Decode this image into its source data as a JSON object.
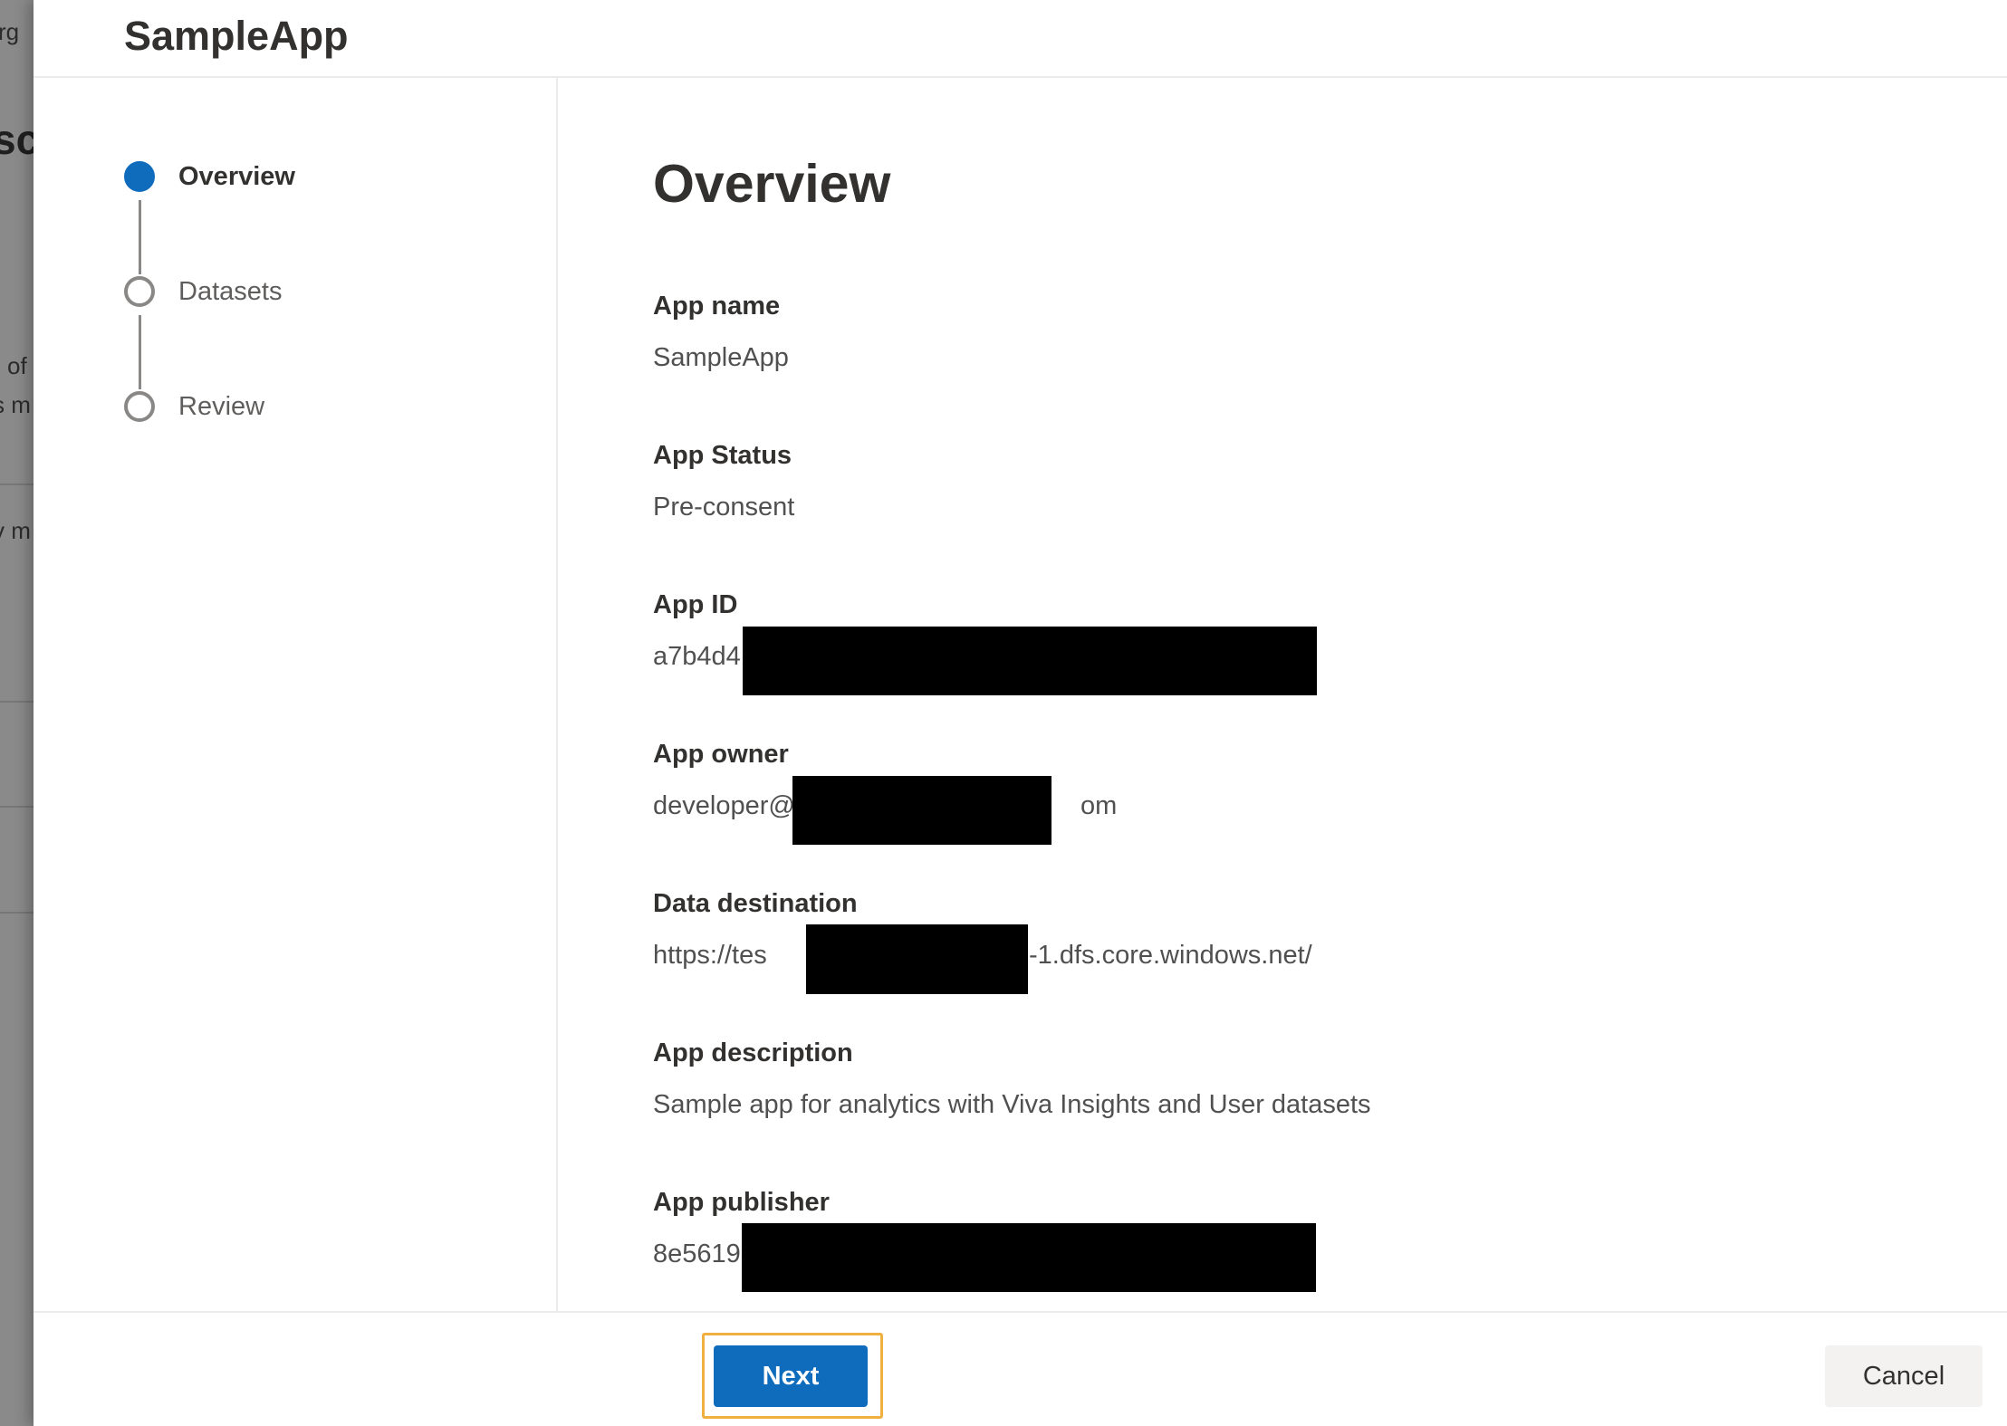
{
  "panel": {
    "title": "SampleApp"
  },
  "steps": [
    {
      "label": "Overview",
      "state": "current"
    },
    {
      "label": "Datasets",
      "state": "pending"
    },
    {
      "label": "Review",
      "state": "pending"
    }
  ],
  "content": {
    "title": "Overview",
    "fields": [
      {
        "label": "App name",
        "value": "SampleApp",
        "redacted": false
      },
      {
        "label": "App Status",
        "value": "Pre-consent",
        "redacted": false
      },
      {
        "label": "App ID",
        "value_visible_prefix": "a7b4d4",
        "redacted": true
      },
      {
        "label": "App owner",
        "value_visible_prefix": "developer@",
        "value_visible_suffix": "om",
        "redacted": true
      },
      {
        "label": "Data destination",
        "value_visible_prefix": "https://tes",
        "value_visible_suffix": "-1.dfs.core.windows.net/",
        "redacted": true
      },
      {
        "label": "App description",
        "value": "Sample app for analytics with Viva Insights and User datasets",
        "redacted": false
      },
      {
        "label": "App publisher",
        "value_visible_prefix": "8e5619",
        "redacted": true
      }
    ]
  },
  "footer": {
    "next_label": "Next",
    "cancel_label": "Cancel"
  },
  "background_fragments": [
    "rg",
    "sc",
    "of",
    "s m",
    "v m"
  ],
  "colors": {
    "accent": "#0f6cbd",
    "focus_ring": "#f0b041",
    "redaction": "#000000"
  }
}
